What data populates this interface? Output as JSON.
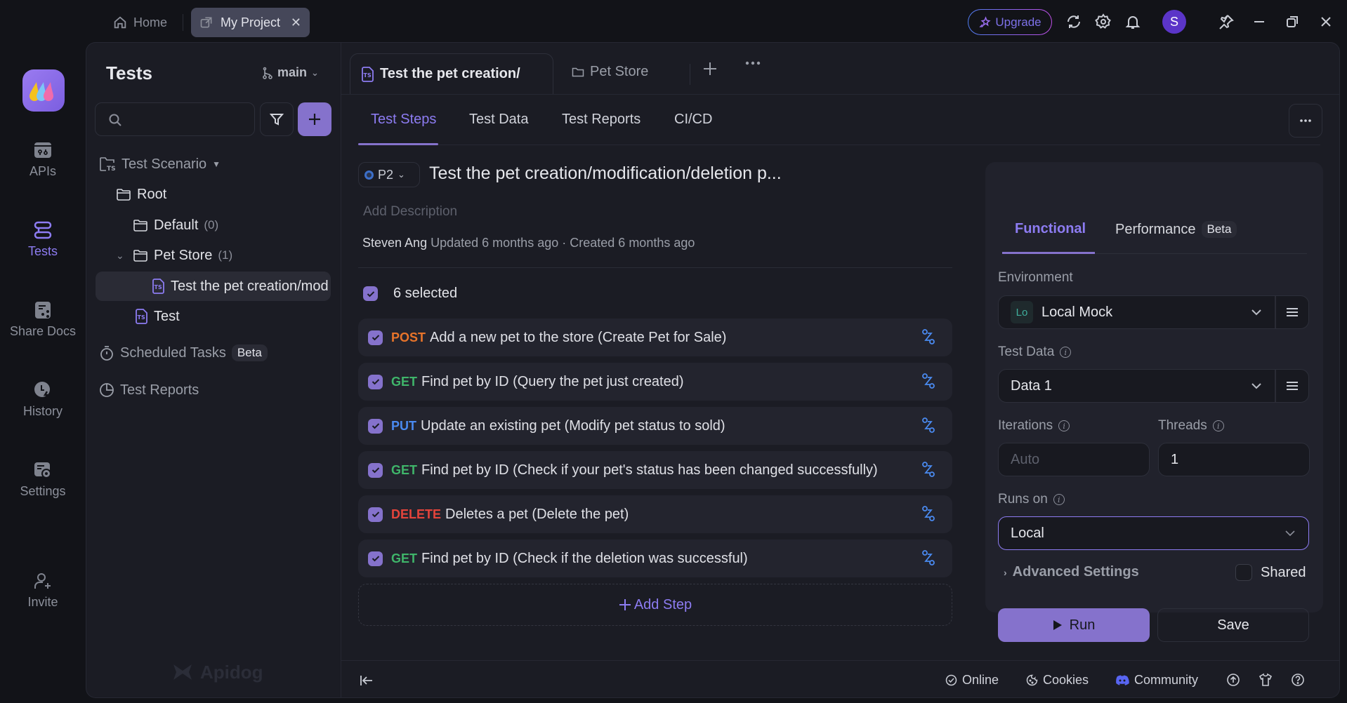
{
  "topbar": {
    "home_tab": "Home",
    "project_tab": "My Project",
    "upgrade_label": "Upgrade",
    "avatar_initial": "S"
  },
  "rail": {
    "items": [
      {
        "label": "APIs",
        "icon": "apis-icon"
      },
      {
        "label": "Tests",
        "icon": "tests-icon",
        "active": true
      },
      {
        "label": "Share Docs",
        "icon": "share-docs-icon"
      },
      {
        "label": "History",
        "icon": "history-icon"
      },
      {
        "label": "Settings",
        "icon": "settings-icon"
      },
      {
        "label": "Invite",
        "icon": "invite-icon"
      }
    ]
  },
  "tree": {
    "title": "Tests",
    "branch": "main",
    "search_placeholder": "",
    "nodes": {
      "scenario": "Test Scenario",
      "root": "Root",
      "default": {
        "label": "Default",
        "count": "(0)"
      },
      "pet_store": {
        "label": "Pet Store",
        "count": "(1)"
      },
      "selected_case": "Test the pet creation/modification/deletion process",
      "test": "Test"
    },
    "scheduled_tasks": "Scheduled Tasks",
    "scheduled_badge": "Beta",
    "test_reports": "Test Reports",
    "watermark": "Apidog"
  },
  "main": {
    "doc_tabs": [
      {
        "label": "Test the pet creation/",
        "active": true
      },
      {
        "label": "Pet Store",
        "active": false
      }
    ],
    "sub_tabs": [
      {
        "label": "Test Steps",
        "active": true
      },
      {
        "label": "Test Data"
      },
      {
        "label": "Test Reports"
      },
      {
        "label": "CI/CD"
      }
    ],
    "priority": "P2",
    "scenario_title": "Test the pet creation/modification/deletion p...",
    "description_placeholder": "Add Description",
    "author": "Steven Ang",
    "updated": "Updated 6 months ago",
    "separator": "·",
    "created": "Created 6 months ago",
    "selected_count": "6 selected",
    "steps": [
      {
        "method": "POST",
        "color": "#e8742a",
        "label": "Add a new pet to the store (Create Pet for Sale)",
        "checked": true
      },
      {
        "method": "GET",
        "color": "#3fb56a",
        "label": "Find pet by ID (Query the pet just created)",
        "checked": true
      },
      {
        "method": "PUT",
        "color": "#4a8af0",
        "label": "Update an existing pet (Modify pet status to sold)",
        "checked": true
      },
      {
        "method": "GET",
        "color": "#3fb56a",
        "label": "Find pet by ID (Check if your pet's status has been changed successfully)",
        "checked": true
      },
      {
        "method": "DELETE",
        "color": "#e5443b",
        "label": "Deletes a pet (Delete the pet)",
        "checked": true
      },
      {
        "method": "GET",
        "color": "#3fb56a",
        "label": "Find pet by ID (Check if the deletion was successful)",
        "checked": true
      }
    ],
    "add_step": "Add Step"
  },
  "run_panel": {
    "tabs": [
      {
        "label": "Functional",
        "active": true
      },
      {
        "label": "Performance",
        "badge": "Beta"
      }
    ],
    "environment_label": "Environment",
    "environment_tag": "Lo",
    "environment_value": "Local Mock",
    "test_data_label": "Test Data",
    "test_data_value": "Data 1",
    "iterations_label": "Iterations",
    "iterations_placeholder": "Auto",
    "threads_label": "Threads",
    "threads_value": "1",
    "runs_on_label": "Runs on",
    "runs_on_value": "Local",
    "advanced_settings": "Advanced Settings",
    "shared_label": "Shared",
    "shared_checked": false,
    "run_label": "Run",
    "save_label": "Save"
  },
  "footer": {
    "online": "Online",
    "cookies": "Cookies",
    "community": "Community"
  },
  "colors": {
    "accent": "#8572cc",
    "accent_text": "#8d7cf2",
    "background": "#121318",
    "panel": "#1b1c24"
  }
}
